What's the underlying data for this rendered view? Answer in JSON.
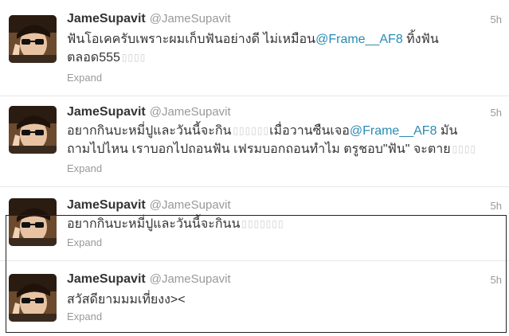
{
  "tweets": [
    {
      "name": "JameSupavit",
      "handle": "@JameSupavit",
      "time": "5h",
      "line1": {
        "pre": "ฟันโอเคครับเพราะผมเก็บฟันอย่างดี ไม่เหมือน",
        "mention": "@Frame__AF8",
        "post": " ทิ้งฟัน"
      },
      "line2": {
        "pre": "ตลอด555",
        "boxes": "▯▯▯▯"
      },
      "expand": "Expand"
    },
    {
      "name": "JameSupavit",
      "handle": "@JameSupavit",
      "time": "5h",
      "line1": {
        "pre": "อยากกินบะหมี่ปูและวันนี้จะกิน",
        "boxes": "▯▯▯▯▯▯",
        "mid": "เมื่อวานซืนเจอ",
        "mention": "@Frame__AF8",
        "post": " มัน"
      },
      "line2": {
        "pre": "ถามไปไหน เราบอกไปถอนฟัน เฟรมบอกถอนทำไม ตรูชอบ\"ฟัน\" จะตาย",
        "boxes": "▯▯▯▯"
      },
      "expand": "Expand"
    },
    {
      "name": "JameSupavit",
      "handle": "@JameSupavit",
      "time": "5h",
      "line1": {
        "pre": "อยากกินบะหมี่ปูและวันนี้จะกินน",
        "boxes": "▯▯▯▯▯▯▯"
      },
      "expand": "Expand"
    },
    {
      "name": "JameSupavit",
      "handle": "@JameSupavit",
      "time": "5h",
      "line1": {
        "pre": "สวัสดียามมมเที่ยงง><"
      },
      "expand": "Expand"
    }
  ]
}
